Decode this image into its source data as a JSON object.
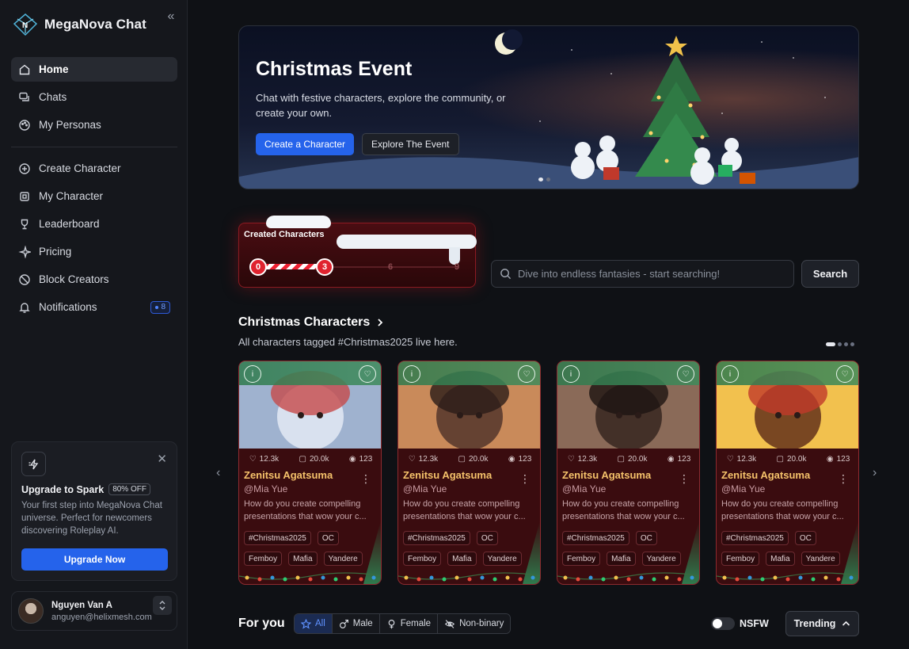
{
  "brand": {
    "name": "MegaNova Chat"
  },
  "nav": {
    "primary": [
      {
        "label": "Home",
        "icon": "home-icon",
        "active": true
      },
      {
        "label": "Chats",
        "icon": "chats-icon"
      },
      {
        "label": "My Personas",
        "icon": "palette-icon"
      }
    ],
    "secondary": [
      {
        "label": "Create Character",
        "icon": "plus-circle-icon"
      },
      {
        "label": "My Character",
        "icon": "cpu-icon"
      },
      {
        "label": "Leaderboard",
        "icon": "trophy-icon"
      },
      {
        "label": "Pricing",
        "icon": "sparkle-icon"
      },
      {
        "label": "Block Creators",
        "icon": "block-icon"
      },
      {
        "label": "Notifications",
        "icon": "bell-icon",
        "badge": "8"
      }
    ]
  },
  "upgrade": {
    "title": "Upgrade to Spark",
    "discount": "80% OFF",
    "description": "Your first step into MegaNova Chat universe. Perfect for newcomers discovering Roleplay AI.",
    "button": "Upgrade Now"
  },
  "user": {
    "name": "Nguyen Van A",
    "email": "anguyen@helixmesh.com"
  },
  "hero": {
    "title": "Christmas Event",
    "description": "Chat with festive characters, explore the community, or create your own.",
    "primary_button": "Create a Character",
    "secondary_button": "Explore The Event"
  },
  "progress": {
    "title": "Created Characters",
    "steps": [
      "0",
      "3",
      "6",
      "9"
    ],
    "current": 3
  },
  "search": {
    "placeholder": "Dive into endless fantasies - start searching!",
    "button": "Search"
  },
  "section": {
    "title": "Christmas Characters",
    "subtitle": "All characters tagged #Christmas2025 live here."
  },
  "cards": [
    {
      "likes": "12.3k",
      "chats": "20.0k",
      "views": "123",
      "name": "Zenitsu Agatsuma",
      "handle": "@Mia Yue",
      "description": "How do you create compelling presentations that wow your c...",
      "tags_row1": [
        "#Christmas2025",
        "OC"
      ],
      "tags_row2": [
        "Femboy",
        "Mafia",
        "Yandere"
      ]
    },
    {
      "likes": "12.3k",
      "chats": "20.0k",
      "views": "123",
      "name": "Zenitsu Agatsuma",
      "handle": "@Mia Yue",
      "description": "How do you create compelling presentations that wow your c...",
      "tags_row1": [
        "#Christmas2025",
        "OC"
      ],
      "tags_row2": [
        "Femboy",
        "Mafia",
        "Yandere"
      ]
    },
    {
      "likes": "12.3k",
      "chats": "20.0k",
      "views": "123",
      "name": "Zenitsu Agatsuma",
      "handle": "@Mia Yue",
      "description": "How do you create compelling presentations that wow your c...",
      "tags_row1": [
        "#Christmas2025",
        "OC"
      ],
      "tags_row2": [
        "Femboy",
        "Mafia",
        "Yandere"
      ]
    },
    {
      "likes": "12.3k",
      "chats": "20.0k",
      "views": "123",
      "name": "Zenitsu Agatsuma",
      "handle": "@Mia Yue",
      "description": "How do you create compelling presentations that wow your c...",
      "tags_row1": [
        "#Christmas2025",
        "OC"
      ],
      "tags_row2": [
        "Femboy",
        "Mafia",
        "Yandere"
      ]
    }
  ],
  "foryou": {
    "title": "For you",
    "filters": [
      "All",
      "Male",
      "Female",
      "Non-binary"
    ],
    "nsfw_label": "NSFW",
    "sort": "Trending"
  },
  "colors": {
    "accent": "#2563eb",
    "card_bg": "#3a0c0f",
    "card_name": "#f5c26b"
  }
}
